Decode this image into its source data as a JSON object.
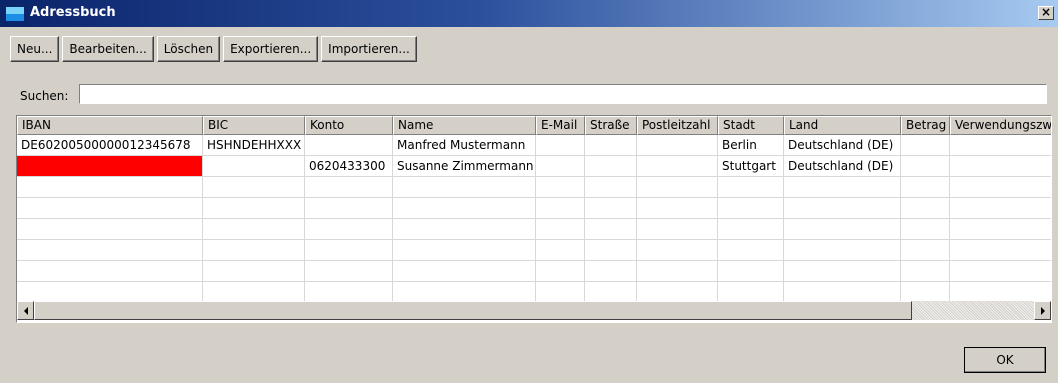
{
  "window": {
    "title": "Adressbuch",
    "close_label": "×"
  },
  "toolbar": {
    "buttons": [
      {
        "id": "new",
        "label": "Neu..."
      },
      {
        "id": "edit",
        "label": "Bearbeiten..."
      },
      {
        "id": "delete",
        "label": "Löschen"
      },
      {
        "id": "export",
        "label": "Exportieren..."
      },
      {
        "id": "import",
        "label": "Importieren..."
      }
    ]
  },
  "search": {
    "label": "Suchen:",
    "value": ""
  },
  "table": {
    "columns": [
      "IBAN",
      "BIC",
      "Konto",
      "Name",
      "E-Mail",
      "Straße",
      "Postleitzahl",
      "Stadt",
      "Land",
      "Betrag",
      "Verwendungszw"
    ],
    "rows": [
      [
        "DE60200500000012345678",
        "HSHNDEHHXXX",
        "",
        "Manfred Mustermann",
        "",
        "",
        "",
        "Berlin",
        "Deutschland (DE)",
        "",
        ""
      ],
      [
        "",
        "",
        "0620433300",
        "Susanne Zimmermann",
        "",
        "",
        "",
        "Stuttgart",
        "Deutschland (DE)",
        "",
        ""
      ],
      [
        "",
        "",
        "",
        "",
        "",
        "",
        "",
        "",
        "",
        "",
        ""
      ],
      [
        "",
        "",
        "",
        "",
        "",
        "",
        "",
        "",
        "",
        "",
        ""
      ],
      [
        "",
        "",
        "",
        "",
        "",
        "",
        "",
        "",
        "",
        "",
        ""
      ],
      [
        "",
        "",
        "",
        "",
        "",
        "",
        "",
        "",
        "",
        "",
        ""
      ],
      [
        "",
        "",
        "",
        "",
        "",
        "",
        "",
        "",
        "",
        "",
        ""
      ],
      [
        "",
        "",
        "",
        "",
        "",
        "",
        "",
        "",
        "",
        "",
        ""
      ]
    ],
    "highlight": {
      "row": 1,
      "col": 0,
      "color": "#ff0000"
    }
  },
  "dialog": {
    "ok_label": "OK"
  },
  "colors": {
    "window_bg": "#d4d0c8",
    "titlebar_start": "#0a246a",
    "titlebar_end": "#a6caf0",
    "highlight": "#ff0000"
  },
  "icons": {
    "app": "address-book-icon",
    "close": "close-icon",
    "scroll_left": "arrow-left-icon",
    "scroll_right": "arrow-right-icon"
  }
}
